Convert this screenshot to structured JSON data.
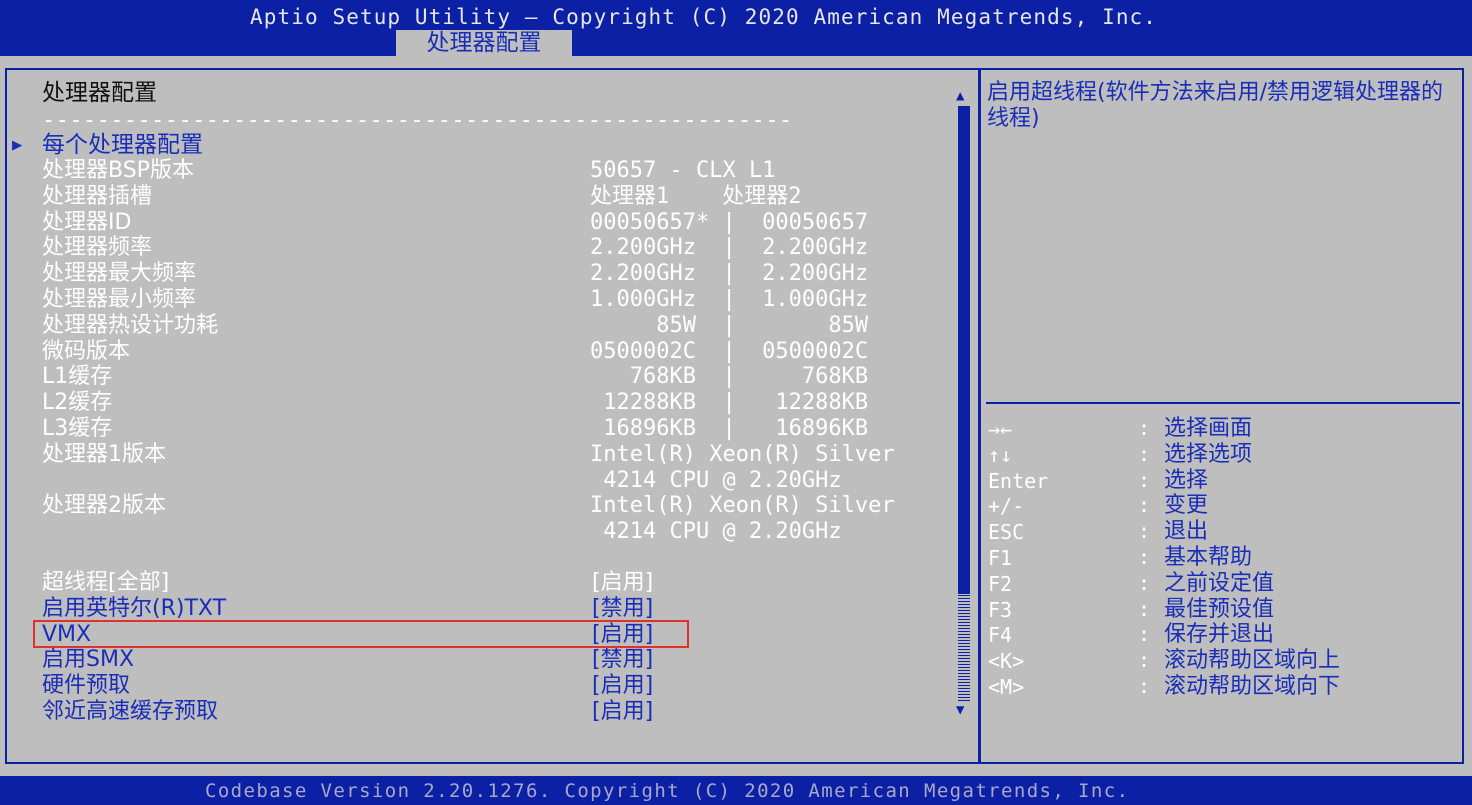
{
  "header": {
    "title": "Aptio Setup Utility – Copyright (C) 2020 American Megatrends, Inc.",
    "active_tab": "处理器配置"
  },
  "main": {
    "heading": "处理器配置",
    "dashes": "-------------------------------------------------------",
    "submenu": "每个处理器配置",
    "info_rows": [
      {
        "label": "处理器BSP版本",
        "value": "50657 - CLX L1"
      },
      {
        "label": "处理器插槽",
        "value": "处理器1    处理器2"
      },
      {
        "label": "处理器ID",
        "value": "00050657* |  00050657"
      },
      {
        "label": "处理器频率",
        "value": "2.200GHz  |  2.200GHz"
      },
      {
        "label": "处理器最大频率",
        "value": "2.200GHz  |  2.200GHz"
      },
      {
        "label": "处理器最小频率",
        "value": "1.000GHz  |  1.000GHz"
      },
      {
        "label": "处理器热设计功耗",
        "value": "     85W  |       85W"
      },
      {
        "label": "微码版本",
        "value": "0500002C  |  0500002C"
      },
      {
        "label": "L1缓存",
        "value": "   768KB  |     768KB"
      },
      {
        "label": "L2缓存",
        "value": " 12288KB  |   12288KB"
      },
      {
        "label": "L3缓存",
        "value": " 16896KB  |   16896KB"
      },
      {
        "label": "处理器1版本",
        "value": "Intel(R) Xeon(R) Silver"
      },
      {
        "label": "",
        "value": " 4214 CPU @ 2.20GHz"
      },
      {
        "label": "处理器2版本",
        "value": "Intel(R) Xeon(R) Silver"
      },
      {
        "label": "",
        "value": " 4214 CPU @ 2.20GHz"
      }
    ],
    "options": [
      {
        "label": "超线程[全部]",
        "value": "[启用]"
      },
      {
        "label": "启用英特尔(R)TXT",
        "value": "[禁用]"
      },
      {
        "label": "VMX",
        "value": "[启用]"
      },
      {
        "label": "启用SMX",
        "value": "[禁用]"
      },
      {
        "label": "硬件预取",
        "value": "[启用]"
      },
      {
        "label": "邻近高速缓存预取",
        "value": "[启用]"
      }
    ]
  },
  "help": {
    "text": "启用超线程(软件方法来启用/禁用逻辑处理器的线程)",
    "keys": [
      {
        "key": "→←",
        "desc": "选择画面"
      },
      {
        "key": "↑↓",
        "desc": "选择选项"
      },
      {
        "key": "Enter",
        "desc": "选择"
      },
      {
        "key": "+/-",
        "desc": "变更"
      },
      {
        "key": "ESC",
        "desc": "退出"
      },
      {
        "key": "F1",
        "desc": "基本帮助"
      },
      {
        "key": "F2",
        "desc": "之前设定值"
      },
      {
        "key": "F3",
        "desc": "最佳预设值"
      },
      {
        "key": "F4",
        "desc": "保存并退出"
      },
      {
        "key": "<K>",
        "desc": "滚动帮助区域向上"
      },
      {
        "key": "<M>",
        "desc": "滚动帮助区域向下"
      }
    ],
    "colon": ":"
  },
  "footer": {
    "text": "Codebase Version 2.20.1276. Copyright (C) 2020 American Megatrends, Inc."
  },
  "colors": {
    "header_blue": "#0b20a4",
    "background_gray": "#bebebe",
    "highlight_red": "#e0322a"
  }
}
